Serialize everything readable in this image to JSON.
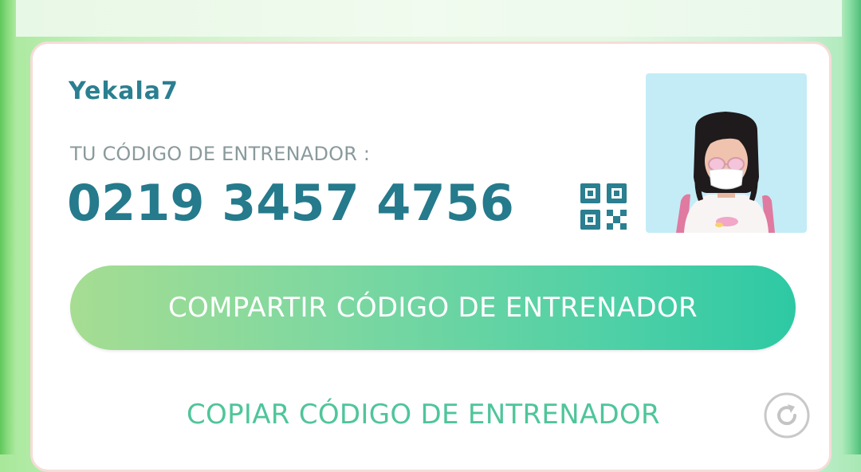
{
  "profile": {
    "username": "Yekala7",
    "code_label": "TU CÓDIGO DE ENTRENADOR :",
    "trainer_code": "0219 3457 4756"
  },
  "actions": {
    "share_label": "COMPARTIR CÓDIGO DE ENTRENADOR",
    "copy_label": "COPIAR CÓDIGO DE ENTRENADOR"
  },
  "icons": {
    "qr": "qr-code-icon",
    "refresh": "refresh-icon"
  },
  "colors": {
    "username": "#2a7f90",
    "code": "#257a8c",
    "label": "#8a9a9c",
    "share_gradient_start": "#a6dd92",
    "share_gradient_end": "#2dc9a4",
    "copy_text": "#4fc59a",
    "avatar_bg": "#c3ecf7"
  }
}
